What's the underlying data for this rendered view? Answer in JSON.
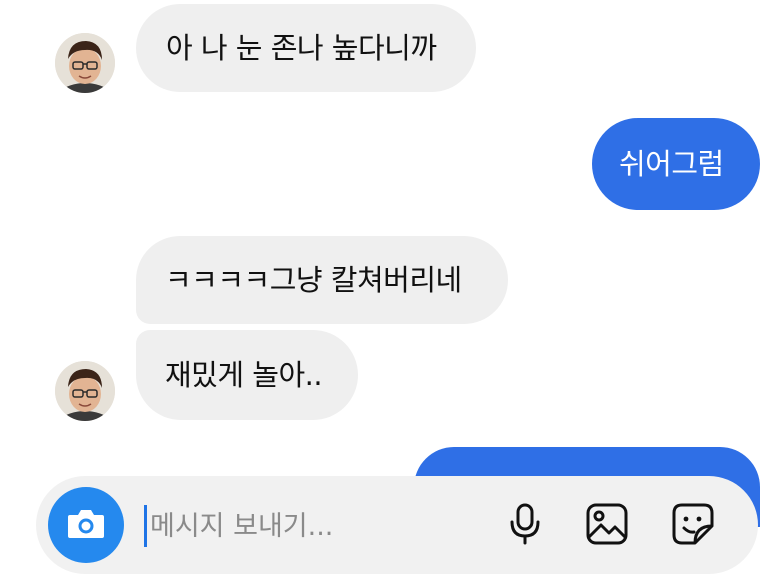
{
  "messages": [
    {
      "id": "m1",
      "from": "other",
      "text": "아 나 눈 존나 높다니까"
    },
    {
      "id": "m2",
      "from": "me",
      "text": "쉬어그럼"
    },
    {
      "id": "m3",
      "from": "other",
      "text": "ㅋㅋㅋㅋ그냥 칼쳐버리네"
    },
    {
      "id": "m4",
      "from": "other",
      "text": "재밌게 놀아.."
    },
    {
      "id": "m5",
      "from": "me",
      "text": ""
    }
  ],
  "composer": {
    "placeholder": "메시지 보내기...",
    "value": "",
    "icons": [
      "camera-icon",
      "microphone-icon",
      "gallery-icon",
      "sticker-icon"
    ]
  },
  "colors": {
    "outgoing_bubble": "#2f6fe6",
    "incoming_bubble": "#efefef",
    "camera_button": "#2589ee",
    "composer_background": "#f1f1f1"
  }
}
